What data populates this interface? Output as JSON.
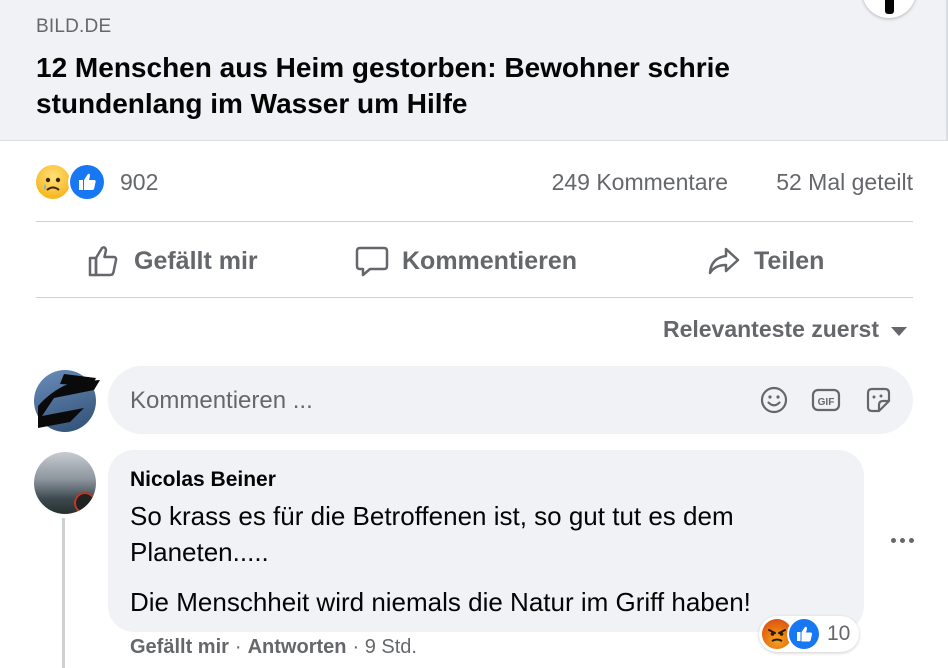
{
  "preview": {
    "source": "BILD.DE",
    "headline": "12 Menschen aus Heim gestorben: Bewohner schrie stundenlang im Wasser um Hilfe"
  },
  "reactions": {
    "icons": [
      "sad-emoji-icon",
      "like-icon"
    ],
    "count": "902",
    "comments": "249 Kommentare",
    "shares": "52 Mal geteilt"
  },
  "actions": {
    "like": "Gefällt mir",
    "comment": "Kommentieren",
    "share": "Teilen"
  },
  "sort": {
    "label": "Relevanteste zuerst"
  },
  "composer": {
    "placeholder": "Kommentieren ..."
  },
  "comment": {
    "author": "Nicolas Beiner",
    "text1": "So krass es für die Betroffenen ist, so gut tut es dem Planeten.....",
    "text2": "Die Menschheit wird niemals die Natur im Griff haben!",
    "reaction_icons": [
      "angry-emoji-icon",
      "like-icon"
    ],
    "reaction_count": "10",
    "like": "Gefällt mir",
    "separator": "·",
    "reply": "Antworten",
    "time": "· 9 Std."
  },
  "colors": {
    "secondary_text": "#65676b",
    "primary_text": "#050505",
    "bubble_bg": "#f0f2f5",
    "like_blue": "#1877f2"
  }
}
